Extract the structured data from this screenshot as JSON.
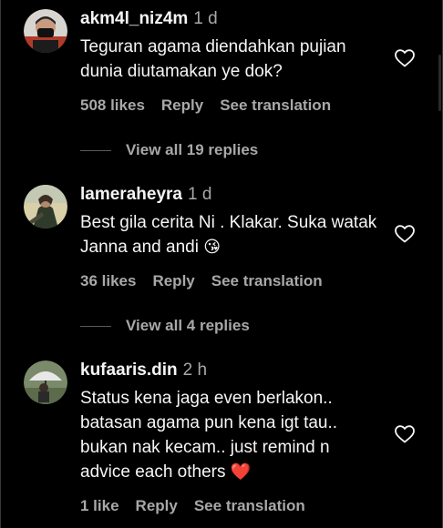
{
  "comments": [
    {
      "username": "akm4l_niz4m",
      "time": "1 d",
      "text": "Teguran agama diendahkan pujian dunia diutamakan ye dok?",
      "emoji": "",
      "likes": "508 likes",
      "reply": "Reply",
      "translate": "See translation",
      "view_replies": "View all 19 replies",
      "avatar": "avatar-person-masked"
    },
    {
      "username": "lameraheyra",
      "time": "1 d",
      "text": "Best gila cerita Ni . Klakar. Suka watak Janna and andi",
      "emoji": "😘",
      "likes": "36 likes",
      "reply": "Reply",
      "translate": "See translation",
      "view_replies": "View all 4 replies",
      "avatar": "avatar-person-outdoor"
    },
    {
      "username": "kufaaris.din",
      "time": "2 h",
      "text": "Status kena jaga even berlakon.. batasan agama pun kena igt tau.. bukan nak kecam.. just remind n advice each others",
      "emoji": "❤️",
      "likes": "1 like",
      "reply": "Reply",
      "translate": "See translation",
      "avatar": "avatar-umbrella"
    }
  ],
  "icons": {
    "like": "heart-outline-icon"
  },
  "colors": {
    "background": "#000000",
    "primary_text": "#f5f5f5",
    "secondary_text": "#a8a8a8",
    "emoji_heart": "#ff3040"
  }
}
